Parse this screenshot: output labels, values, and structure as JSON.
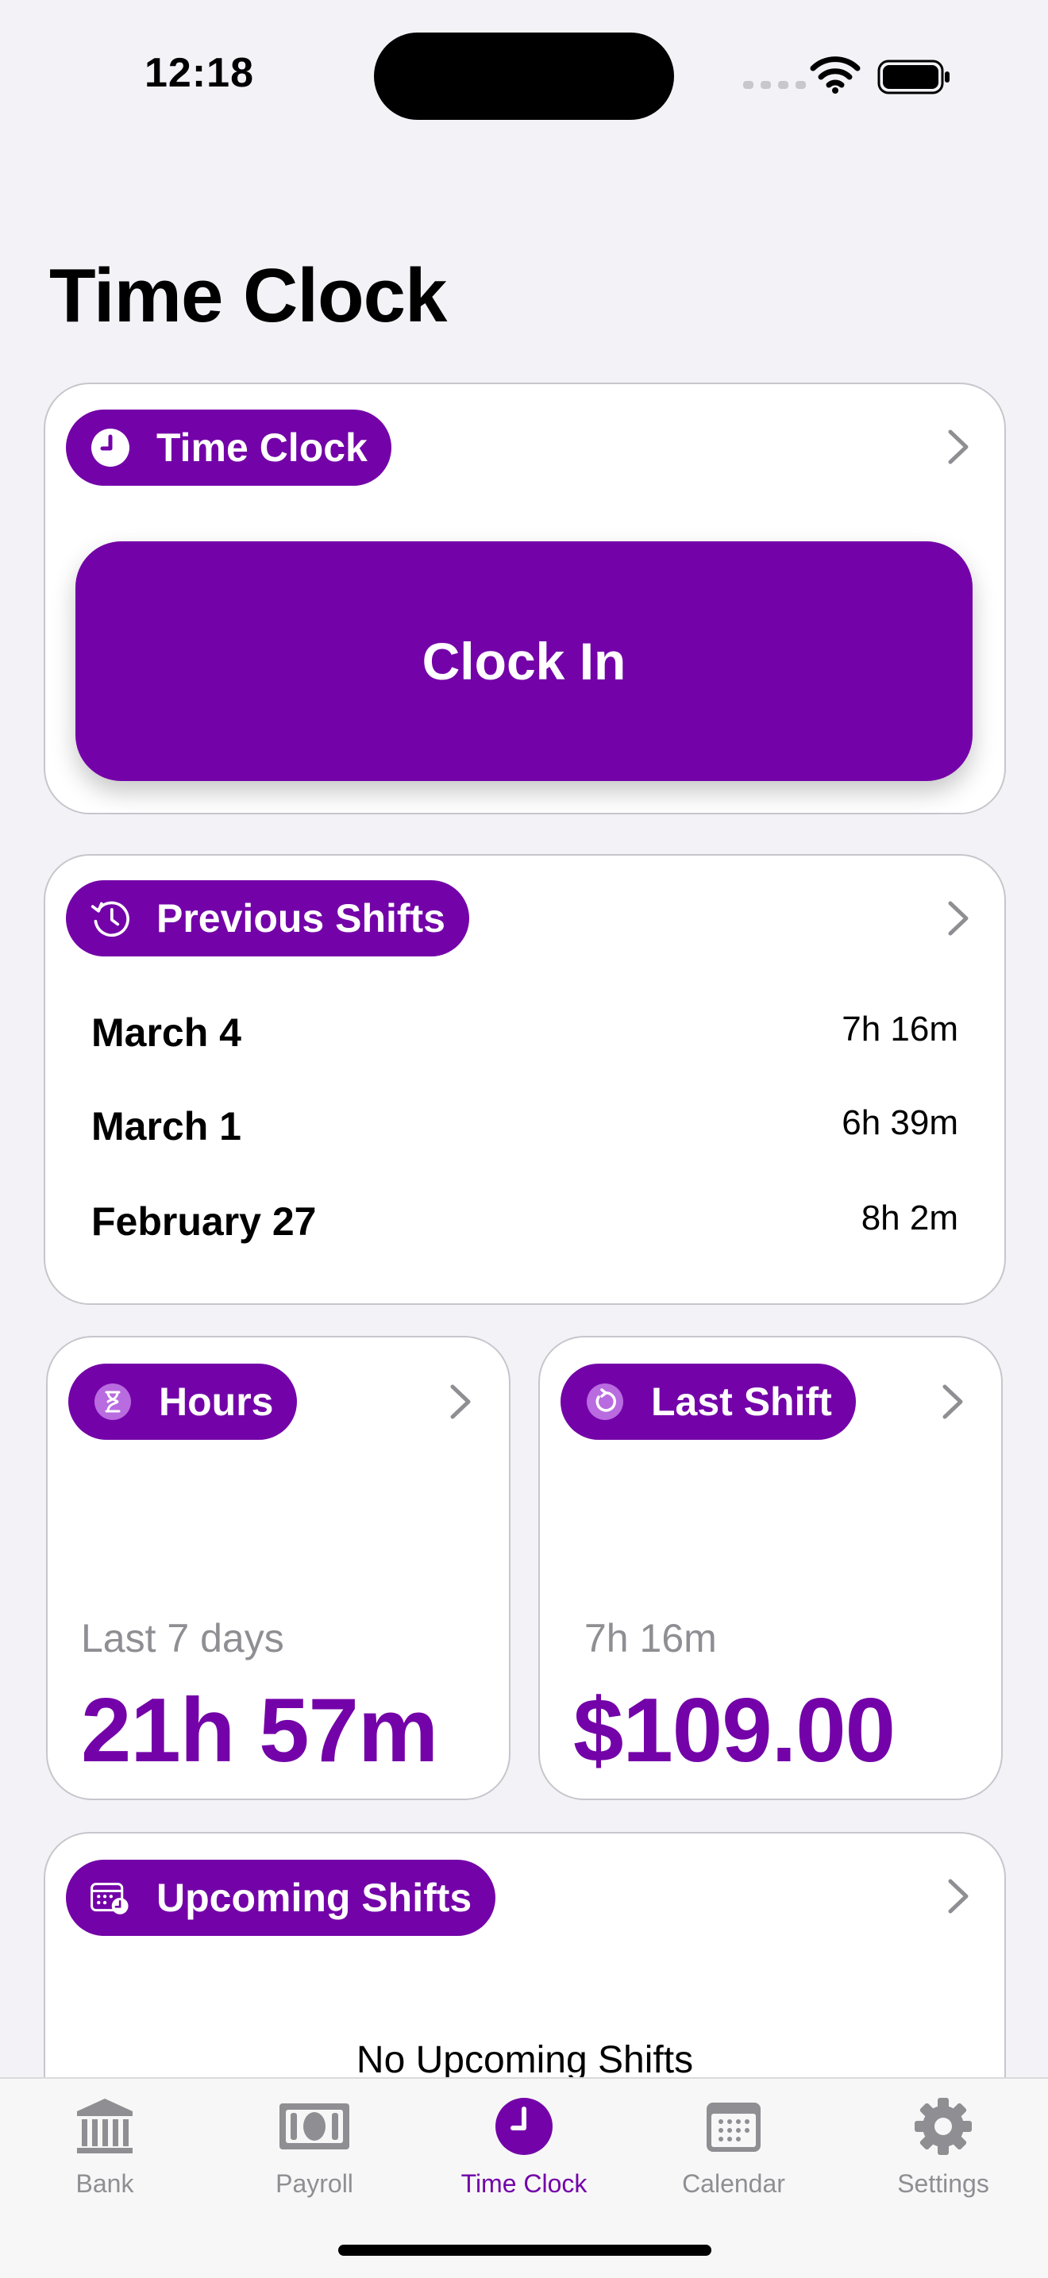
{
  "status_bar": {
    "time": "12:18"
  },
  "page": {
    "title": "Time Clock"
  },
  "time_clock_card": {
    "pill_label": "Time Clock",
    "pill_icon": "clock-icon",
    "clock_in_label": "Clock In"
  },
  "previous_shifts_card": {
    "pill_label": "Previous Shifts",
    "pill_icon": "history-clock-icon",
    "shifts": [
      {
        "date": "March 4",
        "duration": "7h 16m"
      },
      {
        "date": "March 1",
        "duration": "6h 39m"
      },
      {
        "date": "February 27",
        "duration": "8h 2m"
      }
    ]
  },
  "hours_card": {
    "pill_label": "Hours",
    "pill_icon": "hourglass-icon",
    "sub_label": "Last 7 days",
    "value": "21h 57m"
  },
  "last_shift_card": {
    "pill_label": "Last Shift",
    "pill_icon": "refresh-clock-icon",
    "sub_label": "7h 16m",
    "value": "$109.00"
  },
  "upcoming_shifts_card": {
    "pill_label": "Upcoming Shifts",
    "pill_icon": "calendar-clock-icon",
    "empty_text": "No Upcoming Shifts"
  },
  "tab_bar": {
    "tabs": [
      {
        "label": "Bank",
        "icon": "bank-icon",
        "active": false
      },
      {
        "label": "Payroll",
        "icon": "banknote-icon",
        "active": false
      },
      {
        "label": "Time Clock",
        "icon": "clock-icon",
        "active": true
      },
      {
        "label": "Calendar",
        "icon": "calendar-icon",
        "active": false
      },
      {
        "label": "Settings",
        "icon": "gear-icon",
        "active": false
      }
    ]
  },
  "colors": {
    "accent": "#7303a8",
    "background": "#f2f2f7",
    "inactive_tab": "#8e8e93"
  }
}
